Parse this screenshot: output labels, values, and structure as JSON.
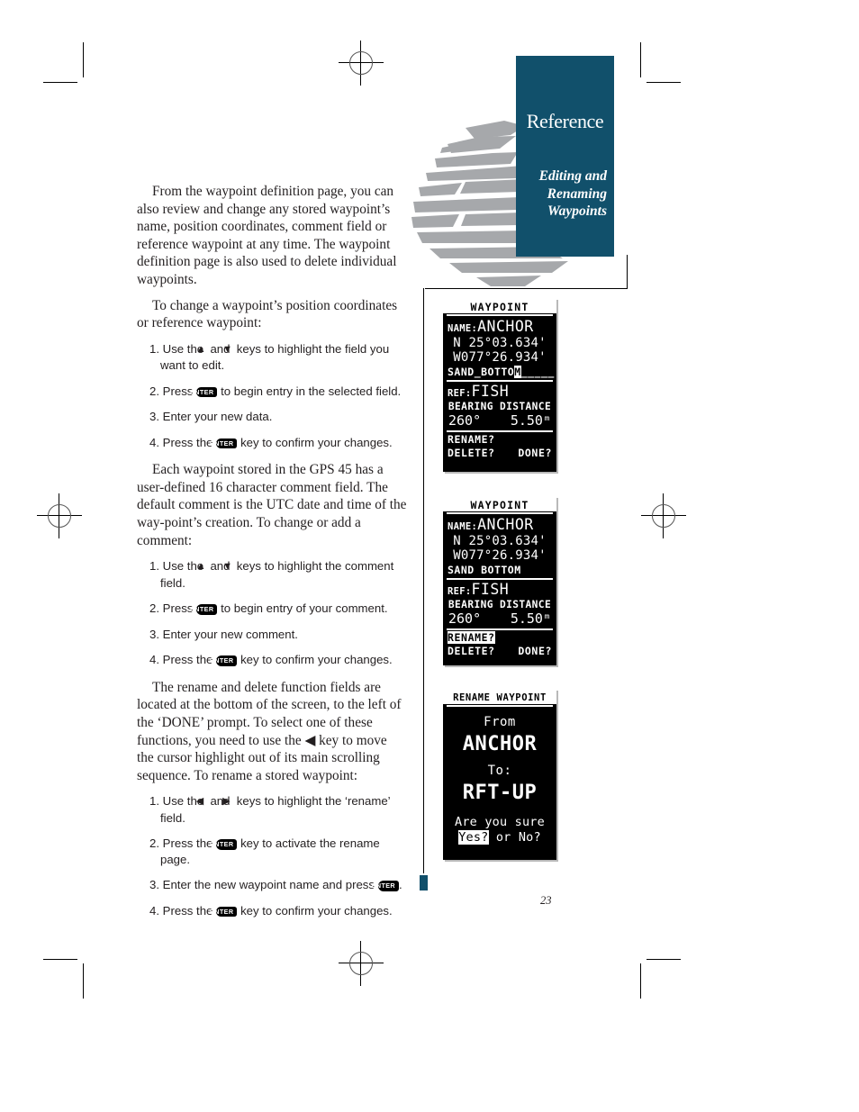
{
  "header": {
    "chapter": "Reference",
    "section": "Editing and\nRenaming\nWaypoints",
    "section_line1": "Editing and",
    "section_line2": "Renaming",
    "section_line3": "Waypoints",
    "band_color": "#11506b"
  },
  "page_number": "23",
  "body": {
    "paragraphs": [
      "From the waypoint definition page, you can also review and change any stored waypoint’s name, position coordinates, comment field or reference waypoint at any time. The waypoint definition page is also used to delete individual waypoints.",
      "To change a waypoint’s position coordinates or reference waypoint:",
      "Each waypoint stored in the GPS 45 has a user-defined 16 character comment field. The default comment is the UTC date and time of the way-point’s creation. To change or add a comment:",
      "The rename and delete function fields are located at the bottom of the screen, to the left of the ‘DONE’ prompt. To select one of these functions, you need to use the ◀ key to move the cursor highlight out of its main scrolling sequence. To rename a stored waypoint:"
    ],
    "step_groups": [
      {
        "steps": [
          {
            "num": "1.",
            "pre": "Use the ",
            "glyph1": "▲",
            "mid": " and ",
            "glyph2": "▼",
            "post": " keys to highlight the field you want to edit."
          },
          {
            "num": "2.",
            "pre": "Press ",
            "key": "ENTER",
            "post": " to begin entry in the selected field."
          },
          {
            "num": "3.",
            "pre": "Enter your new data.",
            "post": ""
          },
          {
            "num": "4.",
            "pre": "Press the ",
            "key": "ENTER",
            "post": " key to confirm your changes."
          }
        ]
      },
      {
        "steps": [
          {
            "num": "1.",
            "pre": "Use the ",
            "glyph1": "▲",
            "mid": " and ",
            "glyph2": "▼",
            "post": " keys to highlight the comment field."
          },
          {
            "num": "2.",
            "pre": "Press ",
            "key": "ENTER",
            "post": " to begin entry of your comment."
          },
          {
            "num": "3.",
            "pre": "Enter your new comment.",
            "post": ""
          },
          {
            "num": "4.",
            "pre": "Press the ",
            "key": "ENTER",
            "post": " key to confirm your changes."
          }
        ]
      },
      {
        "steps": [
          {
            "num": "1.",
            "pre": "Use the ",
            "glyph1": "◀",
            "mid": " and ",
            "glyph2": "▶",
            "post": " keys to highlight the ‘rename’ field."
          },
          {
            "num": "2.",
            "pre": "Press the ",
            "key": "ENTER",
            "post": " key to activate the rename page."
          },
          {
            "num": "3.",
            "pre": "Enter the new waypoint name and press ",
            "key": "ENTER",
            "post": "."
          },
          {
            "num": "4.",
            "pre": "Press the ",
            "key": "ENTER",
            "post": " key to confirm your changes."
          }
        ]
      }
    ]
  },
  "gps_screens": [
    {
      "id": "waypoint-edit-comment",
      "title": "WAYPOINT",
      "name_label": "NAME:",
      "name_value": "ANCHOR",
      "lat": "N  25°03.634'",
      "lon": "W077°26.934'",
      "comment_typed": "SAND_BOTTO",
      "comment_cursor": "M",
      "comment_rest": "_____",
      "ref_label": "REF:",
      "ref_value": "FISH",
      "bd_header": "BEARING DISTANCE",
      "bearing": "260°",
      "distance": "5.50ᵐ",
      "rename_label": "RENAME?",
      "delete_label": "DELETE?",
      "done_label": "DONE?",
      "highlight": "comment"
    },
    {
      "id": "waypoint-rename-highlighted",
      "title": "WAYPOINT",
      "name_label": "NAME:",
      "name_value": "ANCHOR",
      "lat": "N  25°03.634'",
      "lon": "W077°26.934'",
      "comment": "SAND BOTTOM",
      "ref_label": "REF:",
      "ref_value": "FISH",
      "bd_header": "BEARING DISTANCE",
      "bearing": "260°",
      "distance": "5.50ᵐ",
      "rename_label": "RENAME?",
      "delete_label": "DELETE?",
      "done_label": "DONE?",
      "highlight": "rename"
    },
    {
      "id": "rename-waypoint-confirm",
      "title": "RENAME WAYPOINT",
      "from_label": "From",
      "from_value": "ANCHOR",
      "to_label": "To:",
      "to_value": "RFT-UP",
      "confirm_prompt": "Are you sure",
      "yes_label": "Yes?",
      "or_label": " or ",
      "no_label": "No?",
      "highlight": "yes"
    }
  ]
}
